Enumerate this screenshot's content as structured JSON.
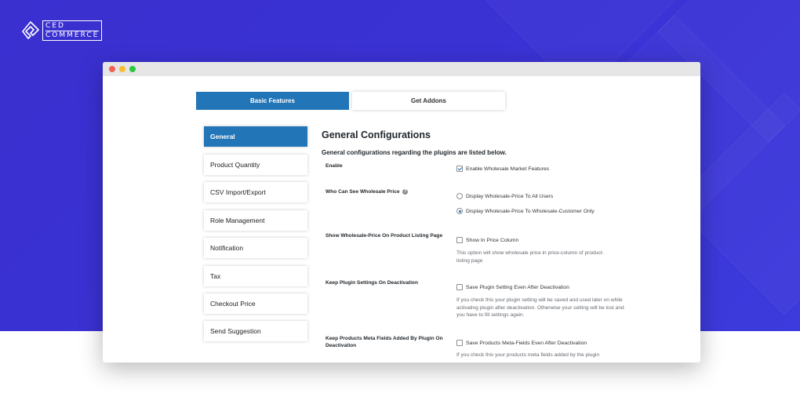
{
  "brand": {
    "line1": "CED",
    "line2": "COMMERCE"
  },
  "tabs": [
    {
      "label": "Basic Features",
      "active": true
    },
    {
      "label": "Get Addons",
      "active": false
    }
  ],
  "sidebar": {
    "items": [
      {
        "label": "General",
        "active": true
      },
      {
        "label": "Product Quantity",
        "active": false
      },
      {
        "label": "CSV Import/Export",
        "active": false
      },
      {
        "label": "Role Management",
        "active": false
      },
      {
        "label": "Notification",
        "active": false
      },
      {
        "label": "Tax",
        "active": false
      },
      {
        "label": "Checkout Price",
        "active": false
      },
      {
        "label": "Send Suggestion",
        "active": false
      }
    ]
  },
  "main": {
    "title": "General Configurations",
    "subtitle": "General configurations regarding the plugins are listed below.",
    "settings": {
      "enable": {
        "label": "Enable",
        "option": "Enable Wholesale Market Features",
        "checked": true
      },
      "who_can_see": {
        "label": "Who Can See Wholesale Price",
        "options": [
          {
            "label": "Display Wholesale-Price To All Users",
            "checked": false
          },
          {
            "label": "Display Wholesale-Price To Wholesale-Customer Only",
            "checked": true
          }
        ]
      },
      "show_on_listing": {
        "label": "Show Wholesale-Price On Product Listing Page",
        "option": "Show In Price Column",
        "checked": false,
        "description": "This option will show wholesale price in price-column of product-listing page"
      },
      "keep_settings": {
        "label": "Keep Plugin Settings On Deactivation",
        "option": "Save Plugin Setting Even After Deactivation",
        "checked": false,
        "description": "If you check this your plugin setting will be saved and used later on while activating plugin after deactivation. Otherwise your setting will be lost and you have to fill settings again."
      },
      "keep_meta": {
        "label": "Keep Products Meta Fields Added By Plugin On Deactivation",
        "option": "Save Products Meta-Fields Even After Deactivation",
        "checked": false,
        "description": "If you check this your products meta fields added by the plugin"
      }
    }
  },
  "colors": {
    "background": "#3a2fcf",
    "accent": "#2275b7",
    "window_bar": "#e6e6e6"
  }
}
